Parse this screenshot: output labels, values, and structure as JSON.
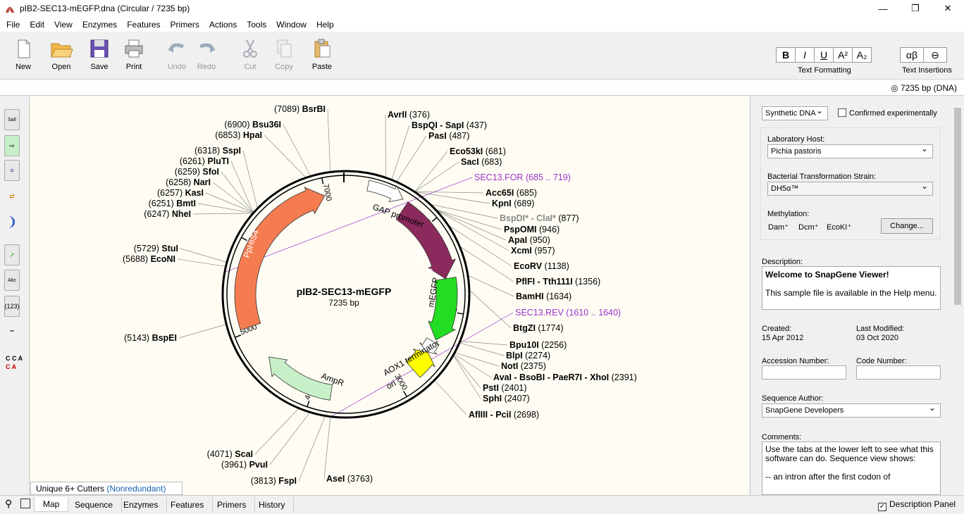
{
  "window": {
    "title": "pIB2-SEC13-mEGFP.dna  (Circular / 7235 bp)",
    "minimize": "—",
    "maximize": "❐",
    "close": "✕"
  },
  "menu": [
    "File",
    "Edit",
    "View",
    "Enzymes",
    "Features",
    "Primers",
    "Actions",
    "Tools",
    "Window",
    "Help"
  ],
  "toolbar": {
    "new": "New",
    "open": "Open",
    "save": "Save",
    "print": "Print",
    "undo": "Undo",
    "redo": "Redo",
    "cut": "Cut",
    "copy": "Copy",
    "paste": "Paste",
    "text_formatting": "Text Formatting",
    "text_insertions": "Text Insertions",
    "bold": "B",
    "italic": "I",
    "underline": "U",
    "superscript": "A²",
    "subscript": "A₂",
    "greek": "αβ",
    "link": "⊖"
  },
  "info": {
    "length": "7235 bp  (DNA)"
  },
  "lefttools": {
    "sali": "SalI",
    "abc": "Abc",
    "num": "(123)",
    "cca": "C C A",
    "cta": "C  A"
  },
  "map": {
    "name": "pIB2-SEC13-mEGFP",
    "length": "7235 bp",
    "ticks": {
      "t1000": "1000",
      "t2000": "2000",
      "t3000": "3000",
      "t4000": "4000",
      "t5000": "5000",
      "t6000": "6000",
      "t7000": "7000"
    },
    "features": {
      "gap": "GAP promoter",
      "sec13": "SEC13",
      "megfp": "mEGFP",
      "aox1": "AOX1 terminator",
      "ori": "ori",
      "ampr": "AmpR",
      "phis4": "PpHIS4"
    },
    "colors": {
      "sec13": "#8b2a5c",
      "megfp": "#22dd22",
      "ori": "#ffff00",
      "ampr": "#c8f0c8",
      "phis4": "#f47c50",
      "primer": "#9933cc"
    },
    "right_sites": [
      {
        "name": "AvrII",
        "pos": "(376)"
      },
      {
        "name": "BspQI - SapI",
        "pos": "(437)"
      },
      {
        "name": "PasI",
        "pos": "(487)"
      },
      {
        "name": "Eco53kI",
        "pos": "(681)"
      },
      {
        "name": "SacI",
        "pos": "(683)"
      },
      {
        "name": "SEC13.FOR",
        "pos": "(685 .. 719)"
      },
      {
        "name": "Acc65I",
        "pos": "(685)"
      },
      {
        "name": "KpnI",
        "pos": "(689)"
      },
      {
        "name": "BspDI* - ClaI*",
        "pos": "(877)"
      },
      {
        "name": "PspOMI",
        "pos": "(946)"
      },
      {
        "name": "ApaI",
        "pos": "(950)"
      },
      {
        "name": "XcmI",
        "pos": "(957)"
      },
      {
        "name": "EcoRV",
        "pos": "(1138)"
      },
      {
        "name": "PflFI - Tth111I",
        "pos": "(1356)"
      },
      {
        "name": "BamHI",
        "pos": "(1634)"
      },
      {
        "name": "SEC13.REV",
        "pos": "(1610 .. 1640)"
      },
      {
        "name": "BtgZI",
        "pos": "(1774)"
      },
      {
        "name": "Bpu10I",
        "pos": "(2256)"
      },
      {
        "name": "BlpI",
        "pos": "(2274)"
      },
      {
        "name": "NotI",
        "pos": "(2375)"
      },
      {
        "name": "AvaI - BsoBI - PaeR7I - XhoI",
        "pos": "(2391)"
      },
      {
        "name": "PstI",
        "pos": "(2401)"
      },
      {
        "name": "SphI",
        "pos": "(2407)"
      },
      {
        "name": "AflIII - PciI",
        "pos": "(2698)"
      },
      {
        "name": "AseI",
        "pos": "(3763)"
      }
    ],
    "left_sites": [
      {
        "name": "BsrBI",
        "pos": "(7089)"
      },
      {
        "name": "Bsu36I",
        "pos": "(6900)"
      },
      {
        "name": "HpaI",
        "pos": "(6853)"
      },
      {
        "name": "SspI",
        "pos": "(6318)"
      },
      {
        "name": "PluTI",
        "pos": "(6261)"
      },
      {
        "name": "SfoI",
        "pos": "(6259)"
      },
      {
        "name": "NarI",
        "pos": "(6258)"
      },
      {
        "name": "KasI",
        "pos": "(6257)"
      },
      {
        "name": "BmtI",
        "pos": "(6251)"
      },
      {
        "name": "NheI",
        "pos": "(6247)"
      },
      {
        "name": "StuI",
        "pos": "(5729)"
      },
      {
        "name": "EcoNI",
        "pos": "(5688)"
      },
      {
        "name": "BspEI",
        "pos": "(5143)"
      },
      {
        "name": "ScaI",
        "pos": "(4071)"
      },
      {
        "name": "PvuI",
        "pos": "(3961)"
      },
      {
        "name": "FspI",
        "pos": "(3813)"
      }
    ]
  },
  "cutters": {
    "label": "Unique 6+ Cutters",
    "mode": "(Nonredundant)"
  },
  "panel": {
    "dna_type": "Synthetic DNA",
    "confirmed": "Confirmed experimentally",
    "lab_host_label": "Laboratory Host:",
    "lab_host": "Pichia pastoris",
    "strain_label": "Bacterial Transformation Strain:",
    "strain": "DH5α™",
    "methylation_label": "Methylation:",
    "dam": "Dam⁺",
    "dcm": "Dcm⁺",
    "ecoki": "EcoKI⁺",
    "change": "Change...",
    "description_label": "Description:",
    "desc_title": "Welcome to SnapGene Viewer!",
    "desc_body": "This sample file is available in the Help menu.",
    "created_label": "Created:",
    "created": "15 Apr 2012",
    "modified_label": "Last Modified:",
    "modified": "03 Oct 2020",
    "accession_label": "Accession Number:",
    "code_label": "Code Number:",
    "author_label": "Sequence Author:",
    "author": "SnapGene Developers",
    "comments_label": "Comments:",
    "comments": "Use the tabs at the lower left to see what this software can do. Sequence view shows:",
    "comments2": "-- an intron after the first codon of"
  },
  "tabs": [
    "Map",
    "Sequence",
    "Enzymes",
    "Features",
    "Primers",
    "History"
  ],
  "desc_panel": "Description Panel"
}
